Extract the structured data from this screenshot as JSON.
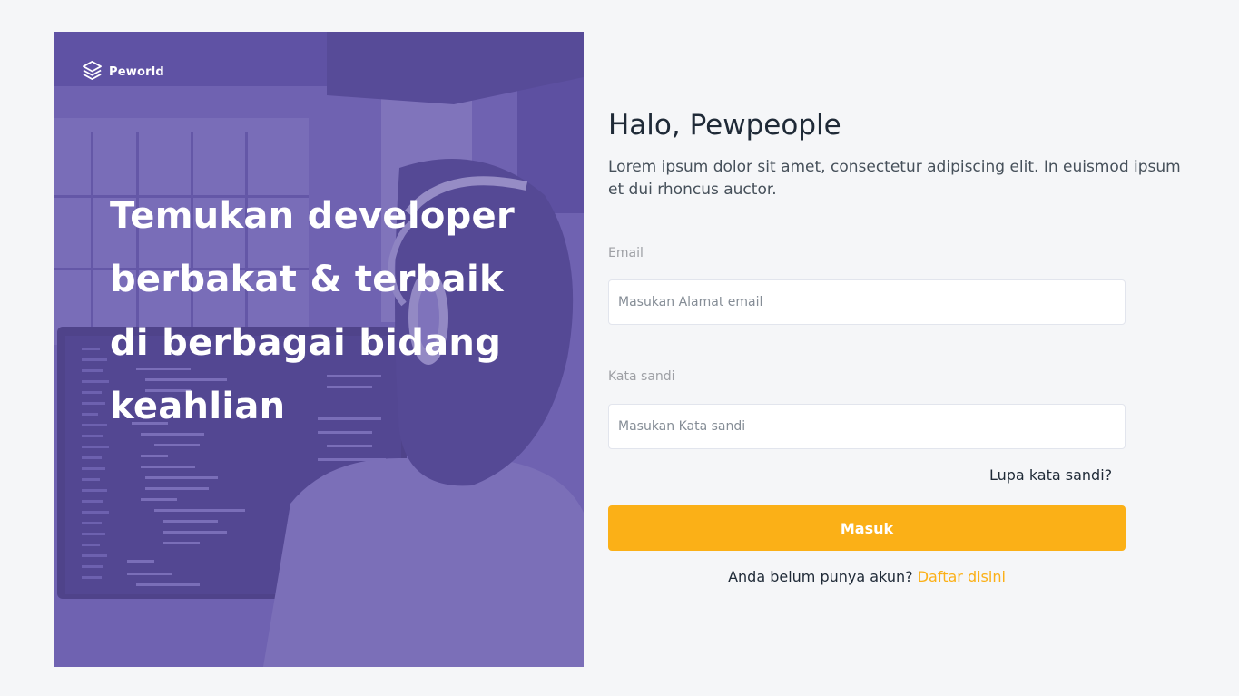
{
  "brand": {
    "name": "Peworld",
    "logo_icon": "layers-icon"
  },
  "hero": {
    "title_lines": [
      "Temukan developer",
      "berbakat & terbaik",
      "di berbagai bidang",
      "keahlian"
    ]
  },
  "form": {
    "heading": "Halo, Pewpeople",
    "subtext": "Lorem ipsum dolor sit amet, consectetur adipiscing elit. In euismod ipsum et dui rhoncus auctor.",
    "email": {
      "label": "Email",
      "placeholder": "Masukan Alamat email",
      "value": ""
    },
    "password": {
      "label": "Kata sandi",
      "placeholder": "Masukan Kata sandi",
      "value": ""
    },
    "forgot_label": "Lupa kata sandi?",
    "submit_label": "Masuk",
    "register_prompt": "Anda belum punya akun?",
    "register_link": "Daftar disini"
  },
  "colors": {
    "accent": "#fbb017",
    "hero_tint": "#5e50a1",
    "background": "#f5f6f8",
    "text_dark": "#1f2a37"
  }
}
